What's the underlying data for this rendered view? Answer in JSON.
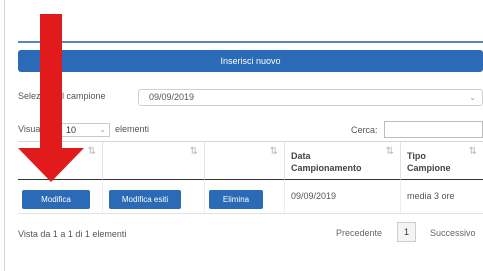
{
  "header": {
    "insert_label": "Inserisci nuovo"
  },
  "filter": {
    "label": "Seleziona il campione",
    "selected": "09/09/2019"
  },
  "length": {
    "label_before": "Visualizza",
    "value": "10",
    "label_after": "elementi"
  },
  "search": {
    "label": "Cerca:",
    "value": ""
  },
  "table": {
    "headers": [
      "",
      "",
      "",
      "Data Campionamento",
      "Tipo Campione"
    ],
    "rows": [
      {
        "edit_label": "Modifica",
        "edit_results_label": "Modifica esiti",
        "delete_label": "Elimina",
        "date": "09/09/2019",
        "type": "media 3 ore"
      }
    ]
  },
  "info": "Vista da 1 a 1 di 1 elementi",
  "pagination": {
    "prev": "Precedente",
    "current": "1",
    "next": "Successivo"
  },
  "colors": {
    "primary": "#2a6ab6",
    "annotation_arrow": "#e11b1b"
  }
}
